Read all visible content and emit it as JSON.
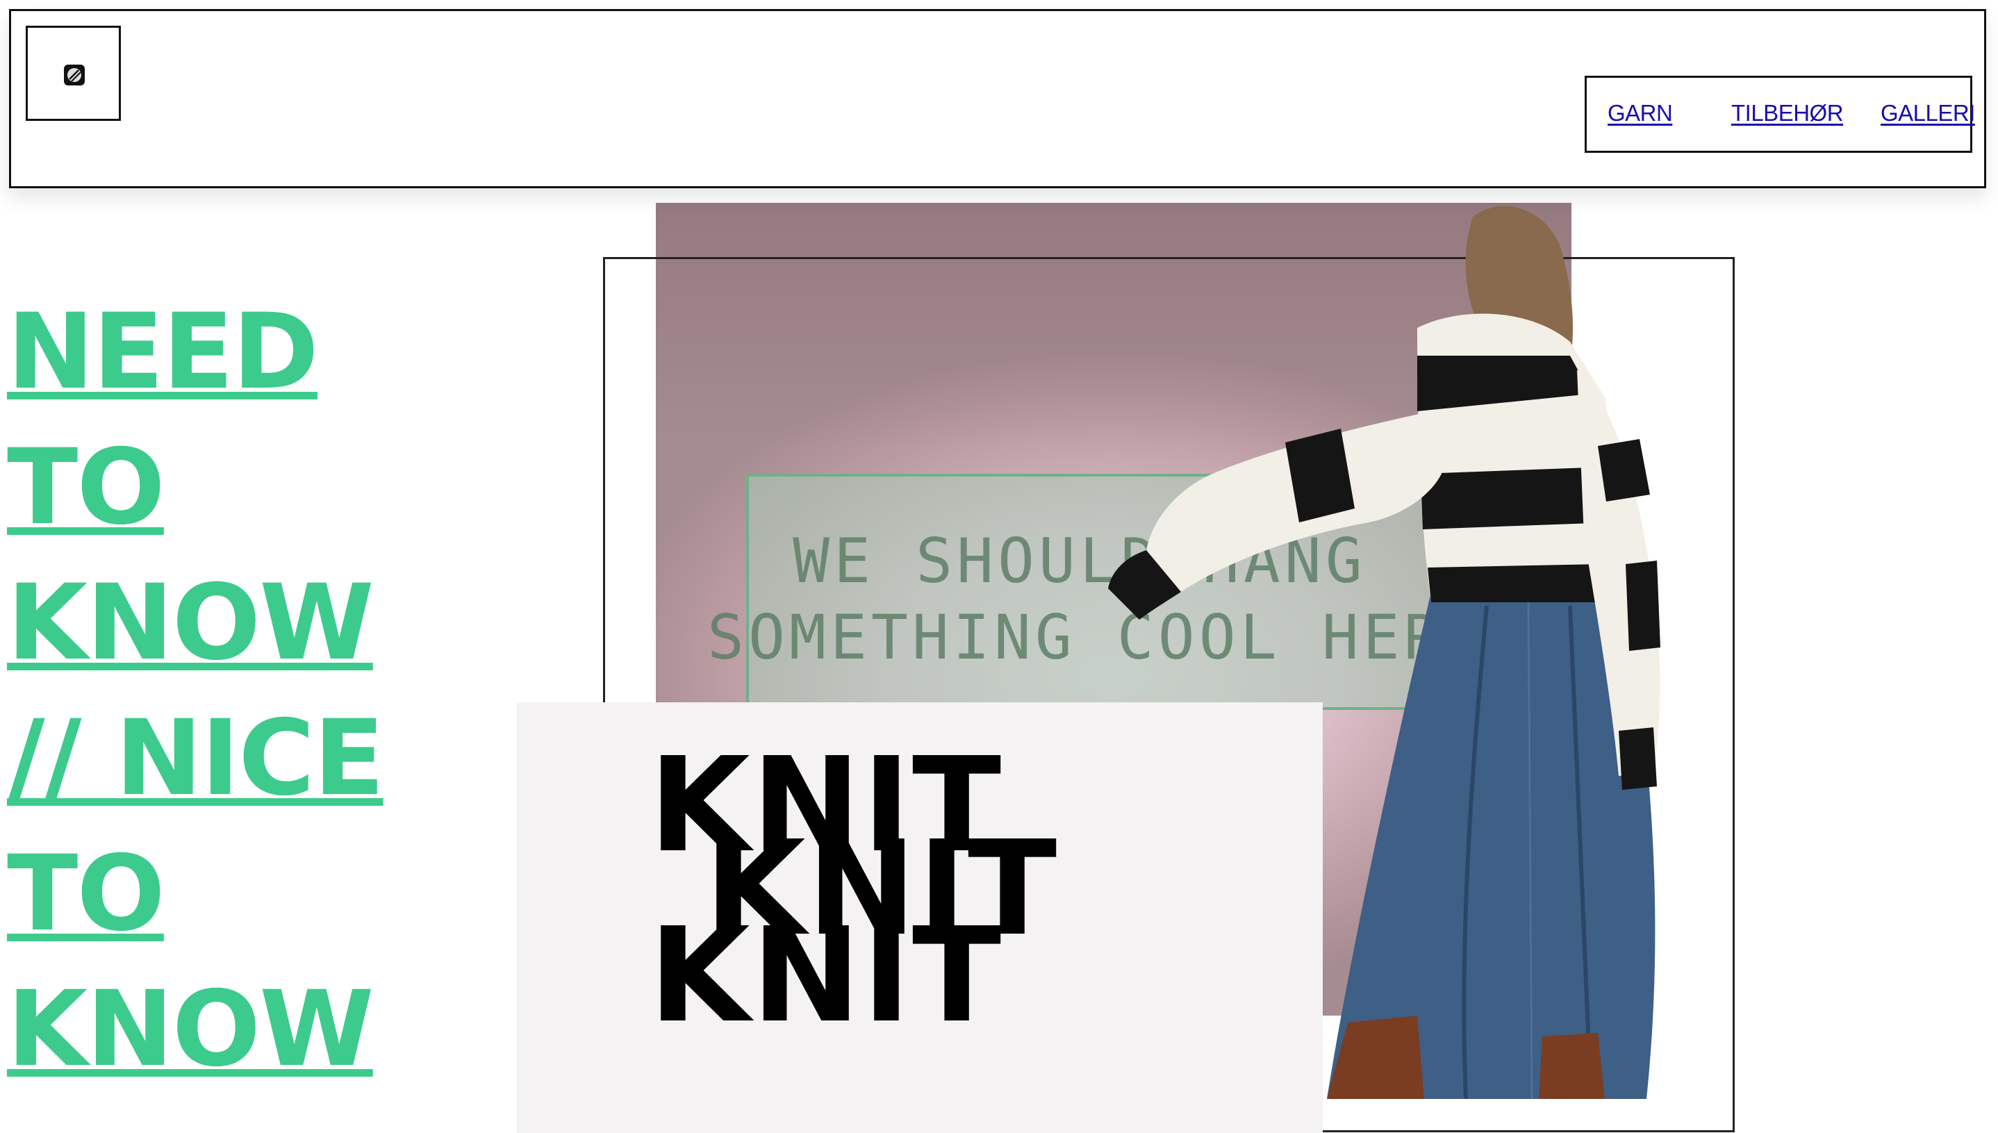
{
  "header": {
    "logo_icon": "yarn-ball-icon",
    "nav": [
      {
        "label": "GARN"
      },
      {
        "label": "TILBEHØR"
      },
      {
        "label": "GALLERI"
      }
    ],
    "link_color": "#1a0dab"
  },
  "hero": {
    "headline_lines": [
      "NEED",
      "TO",
      "KNOW",
      "// NICE",
      "TO",
      "KNOW"
    ],
    "headline_color": "#3ccb8c",
    "sign_lines": [
      "WE SHOULD HANG",
      "SOMETHING COOL HERE"
    ],
    "knit_words": [
      "KNIT",
      "KNIT",
      "KNIT"
    ]
  }
}
